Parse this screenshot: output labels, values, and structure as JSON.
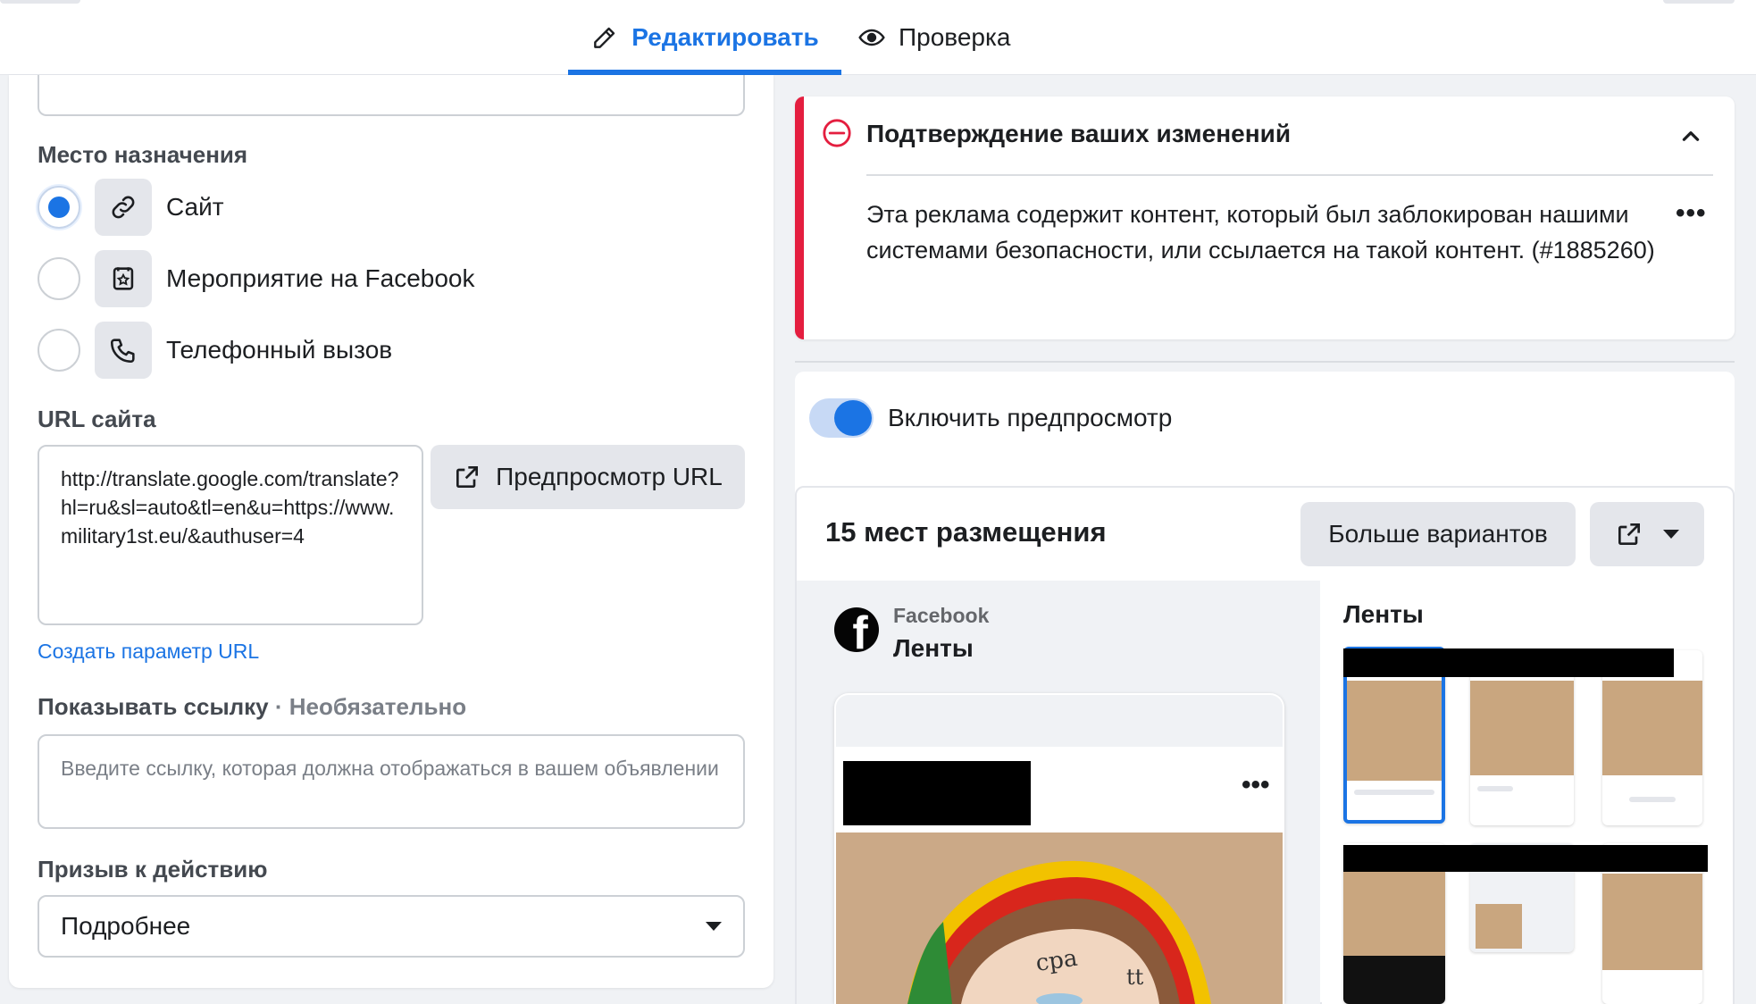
{
  "tabs": {
    "edit_label": "Редактировать",
    "review_label": "Проверка"
  },
  "destination": {
    "section_label": "Место назначения",
    "options": [
      {
        "label": "Сайт",
        "selected": true,
        "icon": "link-icon"
      },
      {
        "label": "Мероприятие на Facebook",
        "selected": false,
        "icon": "event-star-icon"
      },
      {
        "label": "Телефонный вызов",
        "selected": false,
        "icon": "phone-icon"
      }
    ]
  },
  "website_url": {
    "section_label": "URL сайта",
    "value": "http://translate.google.com/translate?hl=ru&sl=auto&tl=en&u=https://www.military1st.eu/&authuser=4",
    "preview_button": "Предпросмотр URL",
    "create_param_link": "Создать параметр URL"
  },
  "display_link": {
    "section_label": "Показывать ссылку",
    "optional_label": " · Необязательно",
    "placeholder": "Введите ссылку, которая должна отображаться в вашем объявлении"
  },
  "call_to_action": {
    "section_label": "Призыв к действию",
    "selected": "Подробнее"
  },
  "alert": {
    "title": "Подтверждение ваших изменений",
    "message": "Эта реклама содержит контент, который был заблокирован нашими системами безопасности, или ссылается на такой контент. (#1885260)",
    "more": "•••",
    "accent_color": "#e41e3f"
  },
  "preview": {
    "toggle_label": "Включить предпросмотр",
    "toggle_on": true,
    "placements_title": "15 мест размещения",
    "more_variants_button": "Больше вариантов",
    "network_name": "Facebook",
    "placement_name": "Ленты",
    "post_more": "•••",
    "thumbs_title": "Ленты"
  },
  "colors": {
    "accent": "#1b74e4",
    "background": "#f0f2f5"
  }
}
